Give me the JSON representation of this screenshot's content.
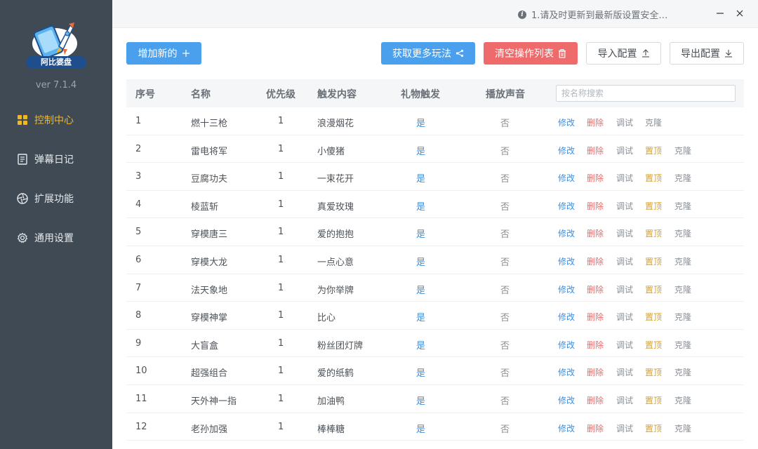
{
  "app": {
    "logo_text": "阿比婆盘",
    "version": "ver 7.1.4",
    "notice": "1.请及时更新到最新版设置安全…",
    "accent_color": "#f2b61f",
    "sidebar_bg": "#3f4a55"
  },
  "sidebar": {
    "items": [
      {
        "label": "控制中心",
        "icon": "grid-icon",
        "active": true
      },
      {
        "label": "弹幕日记",
        "icon": "document-icon",
        "active": false
      },
      {
        "label": "扩展功能",
        "icon": "aperture-icon",
        "active": false
      },
      {
        "label": "通用设置",
        "icon": "gear-icon",
        "active": false
      }
    ]
  },
  "window": {
    "minimize": "minimize-icon",
    "close": "close-icon"
  },
  "toolbar": {
    "add_label": "增加新的",
    "more_label": "获取更多玩法",
    "clear_label": "清空操作列表",
    "import_label": "导入配置",
    "export_label": "导出配置"
  },
  "table": {
    "headers": [
      "序号",
      "名称",
      "优先级",
      "触发内容",
      "礼物触发",
      "播放声音"
    ],
    "search_placeholder": "按名称搜索",
    "actions": {
      "edit": "修改",
      "delete": "删除",
      "debug": "调试",
      "top": "置顶",
      "clone": "克隆"
    },
    "rows": [
      {
        "idx": "1",
        "name": "燃十三枪",
        "priority": "1",
        "trigger": "浪漫烟花",
        "gift": "是",
        "sound": "否",
        "show_top": false
      },
      {
        "idx": "2",
        "name": "雷电将军",
        "priority": "1",
        "trigger": "小傻猪",
        "gift": "是",
        "sound": "否",
        "show_top": true
      },
      {
        "idx": "3",
        "name": "豆腐功夫",
        "priority": "1",
        "trigger": "一束花开",
        "gift": "是",
        "sound": "否",
        "show_top": true
      },
      {
        "idx": "4",
        "name": "棱蓝斩",
        "priority": "1",
        "trigger": "真爱玫瑰",
        "gift": "是",
        "sound": "否",
        "show_top": true
      },
      {
        "idx": "5",
        "name": "穿模唐三",
        "priority": "1",
        "trigger": "爱的抱抱",
        "gift": "是",
        "sound": "否",
        "show_top": true
      },
      {
        "idx": "6",
        "name": "穿模大龙",
        "priority": "1",
        "trigger": "一点心意",
        "gift": "是",
        "sound": "否",
        "show_top": true
      },
      {
        "idx": "7",
        "name": "法天象地",
        "priority": "1",
        "trigger": "为你举牌",
        "gift": "是",
        "sound": "否",
        "show_top": true
      },
      {
        "idx": "8",
        "name": "穿模神掌",
        "priority": "1",
        "trigger": "比心",
        "gift": "是",
        "sound": "否",
        "show_top": true
      },
      {
        "idx": "9",
        "name": "大盲盒",
        "priority": "1",
        "trigger": "粉丝团灯牌",
        "gift": "是",
        "sound": "否",
        "show_top": true
      },
      {
        "idx": "10",
        "name": "超强组合",
        "priority": "1",
        "trigger": "爱的纸鹤",
        "gift": "是",
        "sound": "否",
        "show_top": true
      },
      {
        "idx": "11",
        "name": "天外神一指",
        "priority": "1",
        "trigger": "加油鸭",
        "gift": "是",
        "sound": "否",
        "show_top": true
      },
      {
        "idx": "12",
        "name": "老孙加强",
        "priority": "1",
        "trigger": "棒棒糖",
        "gift": "是",
        "sound": "否",
        "show_top": true
      }
    ]
  }
}
